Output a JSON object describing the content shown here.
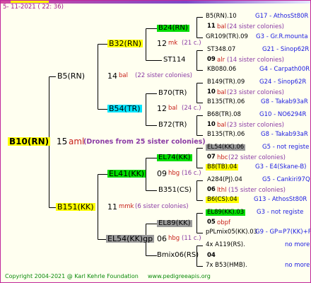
{
  "header": {
    "date_line": "5- 11-2021 ( 22: 36)",
    "top_bar_colors": [
      "#d14aa0",
      "#7d48c9",
      "#ffff00"
    ]
  },
  "gen0": {
    "label": "B10(RN)",
    "num": "15",
    "code": "aml",
    "note": "(Drones from 25 sister colonies)"
  },
  "gen1": [
    {
      "label": "B5(RN)",
      "num": "14",
      "code": "bal",
      "note": "(22 sister colonies)"
    },
    {
      "label": "B151(KK)",
      "num": "11",
      "code": "mmk",
      "note": "(6 sister colonies)"
    }
  ],
  "gen2": [
    {
      "label": "B32(RN)",
      "num": "12",
      "code": "mk",
      "note": "(21 c.)"
    },
    {
      "label": "B54(TR)",
      "num": "12",
      "code": "bal",
      "note": "(24 c.)"
    },
    {
      "label": "EL41(KK)",
      "num": "09",
      "code": "hbg",
      "note": "(16 c.)"
    },
    {
      "label": "EL54(KK)gp",
      "num": "06",
      "code": "hbg",
      "note": "(11 c.)"
    }
  ],
  "gen3": [
    {
      "label": "B24(RN)"
    },
    {
      "label": "ST114"
    },
    {
      "label": "B70(TR)"
    },
    {
      "label": "B72(TR)"
    },
    {
      "label": "EL74(KK)"
    },
    {
      "label": "B351(CS)"
    },
    {
      "label": "EL89(KK)"
    },
    {
      "label": "Bmix06(RS)"
    }
  ],
  "gen4": [
    {
      "a": "B5(RN).10",
      "a_pg": "G17 - AthosSt80R",
      "num": "11",
      "code": "bal",
      "note": "(24 sister colonies)",
      "b": "GR109(TR).09",
      "b_pg": "G3 - Gr.R.mounta"
    },
    {
      "a": "ST348.07",
      "a_pg": "G21 - Sinop62R",
      "num": "09",
      "code": "alr",
      "note": "(14 sister colonies)",
      "b": "KB080.06",
      "b_pg": "G4 - Carpath00R"
    },
    {
      "a": "B149(TR).09",
      "a_pg": "G24 - Sinop62R",
      "num": "10",
      "code": "bal",
      "note": "(23 sister colonies)",
      "b": "B135(TR).06",
      "b_pg": "G8 - Takab93aR"
    },
    {
      "a": "B68(TR).08",
      "a_pg": "G10 - NO6294R",
      "num": "10",
      "code": "bal",
      "note": "(23 sister colonies)",
      "b": "B135(TR).06",
      "b_pg": "G8 - Takab93aR"
    },
    {
      "a": "EL54(KK).06",
      "a_pg": "G5 - not registe",
      "num": "07",
      "code": "hbc",
      "note": "(22 sister colonies)",
      "b": "B8(TB).04",
      "b_pg": "G3 - E4(Skane-B)"
    },
    {
      "a": "A284(PJ).04",
      "a_pg": "G5 - Cankiri97Q",
      "num": "06",
      "code": "lthl",
      "note": "(15 sister colonies)",
      "b": "B6(CS).04",
      "b_pg": "G13 - AthosSt80R"
    },
    {
      "a": "EL89(KK).03",
      "a_pg": "G3 - not registe",
      "num": "05",
      "code": "obpf",
      "note": "",
      "b": "pPLmix05(KK).03",
      "b_pg": "G9 - GP=P7(KK)+P"
    },
    {
      "a": "4x A119(RS).",
      "a_pg": "no more",
      "num": "04",
      "code": "",
      "note": "",
      "b": "7x B53(HMB).",
      "b_pg": "no more"
    }
  ],
  "footer": {
    "copyright": "Copyright 2004-2021 @ Karl Kehrle Foundation",
    "website": "www.pedigreeapis.org"
  }
}
